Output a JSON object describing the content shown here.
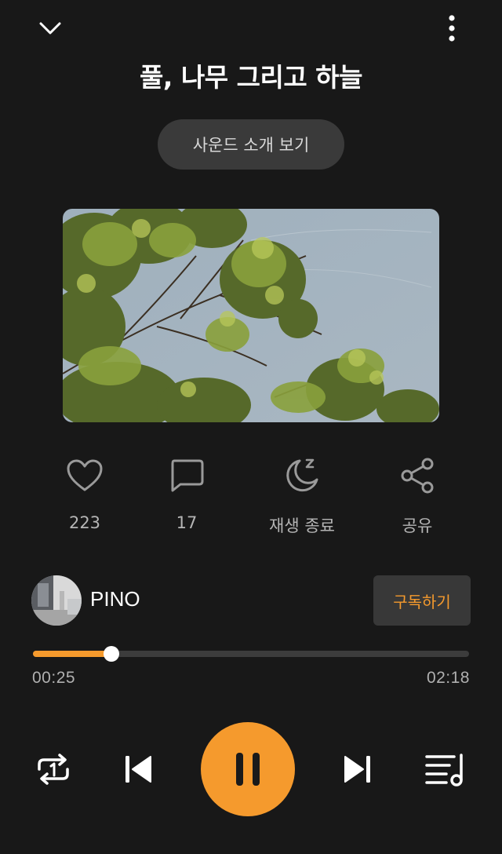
{
  "header": {
    "title": "풀, 나무 그리고 하늘",
    "intro_button_label": "사운드 소개 보기"
  },
  "cover_image": {
    "alt": "tree-branches-sky"
  },
  "actions": [
    {
      "icon": "heart-icon",
      "label": "223"
    },
    {
      "icon": "comment-icon",
      "label": "17"
    },
    {
      "icon": "sleep-timer-icon",
      "label": "재생 종료"
    },
    {
      "icon": "share-icon",
      "label": "공유"
    }
  ],
  "artist": {
    "name": "PINO",
    "subscribe_label": "구독하기"
  },
  "player": {
    "current_time": "00:25",
    "total_time": "02:18",
    "progress_fraction": 0.18,
    "state": "playing",
    "accent_color": "#f59a2d"
  },
  "controls": [
    {
      "icon": "repeat-one-icon"
    },
    {
      "icon": "previous-track-icon"
    },
    {
      "icon": "pause-icon"
    },
    {
      "icon": "next-track-icon"
    },
    {
      "icon": "playlist-icon"
    }
  ]
}
